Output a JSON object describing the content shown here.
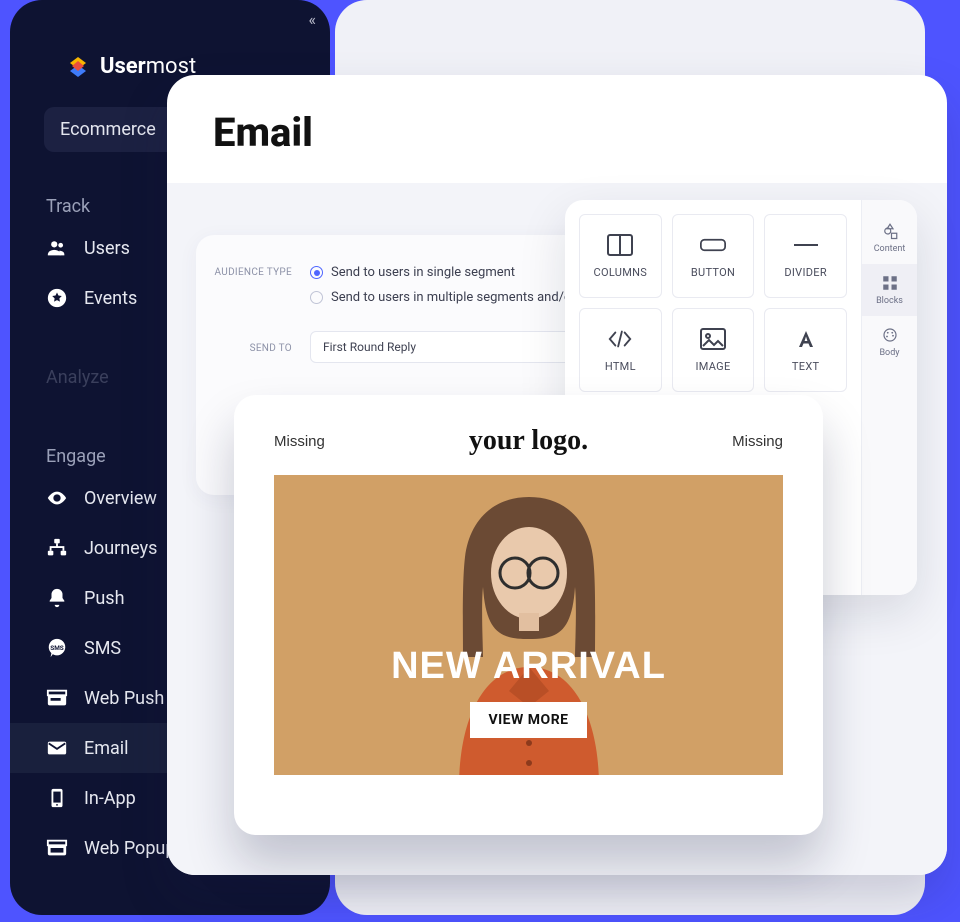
{
  "logo": {
    "text_bold": "User",
    "text_rest": "most"
  },
  "workspace": {
    "label": "Ecommerce"
  },
  "sections": {
    "track": "Track",
    "analyze": "Analyze",
    "engage": "Engage"
  },
  "nav": {
    "track": [
      {
        "label": "Users"
      },
      {
        "label": "Events"
      }
    ],
    "engage": [
      {
        "label": "Overview"
      },
      {
        "label": "Journeys"
      },
      {
        "label": "Push"
      },
      {
        "label": "SMS"
      },
      {
        "label": "Web Push"
      },
      {
        "label": "Email"
      },
      {
        "label": "In-App"
      },
      {
        "label": "Web Popup"
      }
    ]
  },
  "page": {
    "title": "Email"
  },
  "audience": {
    "label": "AUDIENCE TYPE",
    "opt1": "Send to users in single segment",
    "opt2": "Send to users in multiple segments and/or D",
    "sendto_label": "SEND TO",
    "sendto_value": "First Round Reply"
  },
  "palette": {
    "blocks": [
      {
        "label": "COLUMNS"
      },
      {
        "label": "BUTTON"
      },
      {
        "label": "DIVIDER"
      },
      {
        "label": "HTML"
      },
      {
        "label": "IMAGE"
      },
      {
        "label": "TEXT"
      }
    ],
    "tabs": [
      {
        "label": "Content"
      },
      {
        "label": "Blocks"
      },
      {
        "label": "Body"
      }
    ]
  },
  "preview": {
    "missing_left": "Missing",
    "missing_right": "Missing",
    "logo_text": "your logo.",
    "headline": "NEW ARRIVAL",
    "cta": "VIEW MORE"
  }
}
